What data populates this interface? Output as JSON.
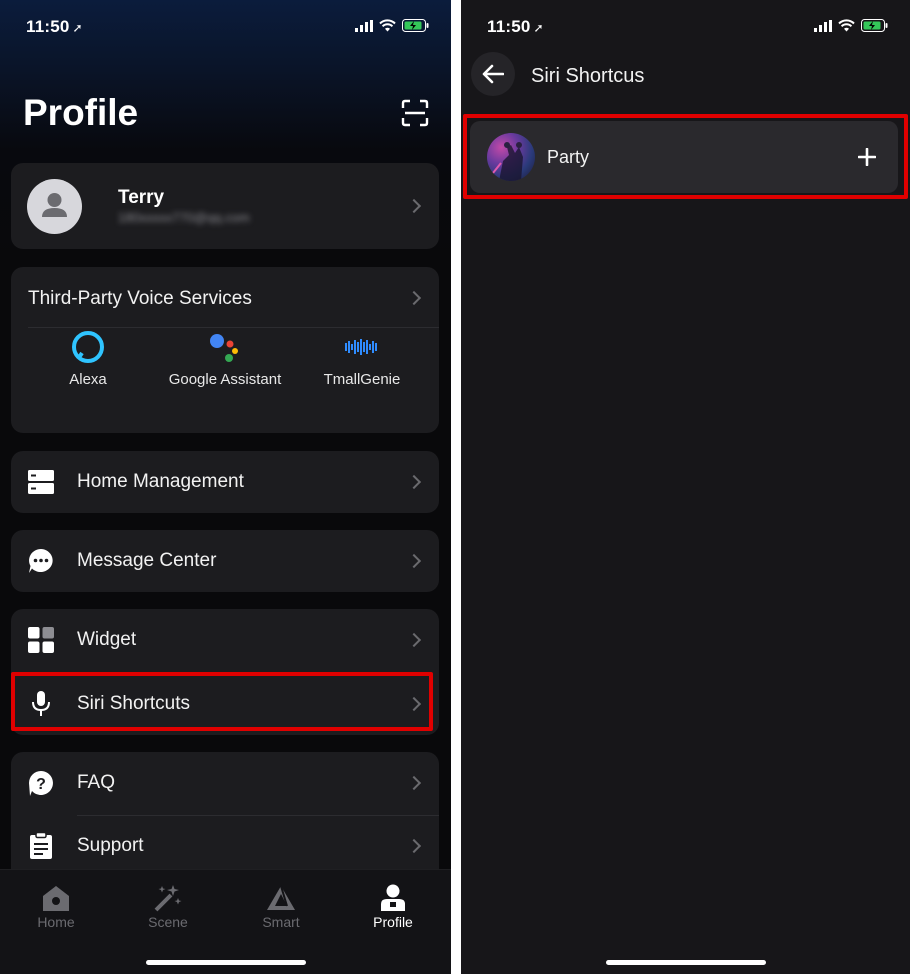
{
  "left": {
    "status": {
      "time": "11:50"
    },
    "title": "Profile",
    "profile": {
      "name": "Terry",
      "email": "180xxxxx770@qq.com"
    },
    "voice": {
      "title": "Third-Party Voice Services",
      "items": [
        {
          "label": "Alexa",
          "icon": "alexa-icon"
        },
        {
          "label": "Google Assistant",
          "icon": "google-assistant-icon"
        },
        {
          "label": "TmallGenie",
          "icon": "tmallgenie-icon"
        }
      ]
    },
    "menu": {
      "home_management": "Home Management",
      "message_center": "Message Center",
      "widget": "Widget",
      "siri_shortcuts": "Siri Shortcuts",
      "faq": "FAQ",
      "support": "Support"
    },
    "tabs": [
      {
        "label": "Home",
        "icon": "home-icon"
      },
      {
        "label": "Scene",
        "icon": "magic-wand-icon"
      },
      {
        "label": "Smart",
        "icon": "smart-triangle-icon"
      },
      {
        "label": "Profile",
        "icon": "profile-icon"
      }
    ]
  },
  "right": {
    "status": {
      "time": "11:50"
    },
    "header": {
      "title": "Siri Shortcus"
    },
    "shortcuts": [
      {
        "label": "Party"
      }
    ]
  },
  "colors": {
    "highlight": "#e00000",
    "background": "#141316",
    "card": "#1c1c1f"
  }
}
